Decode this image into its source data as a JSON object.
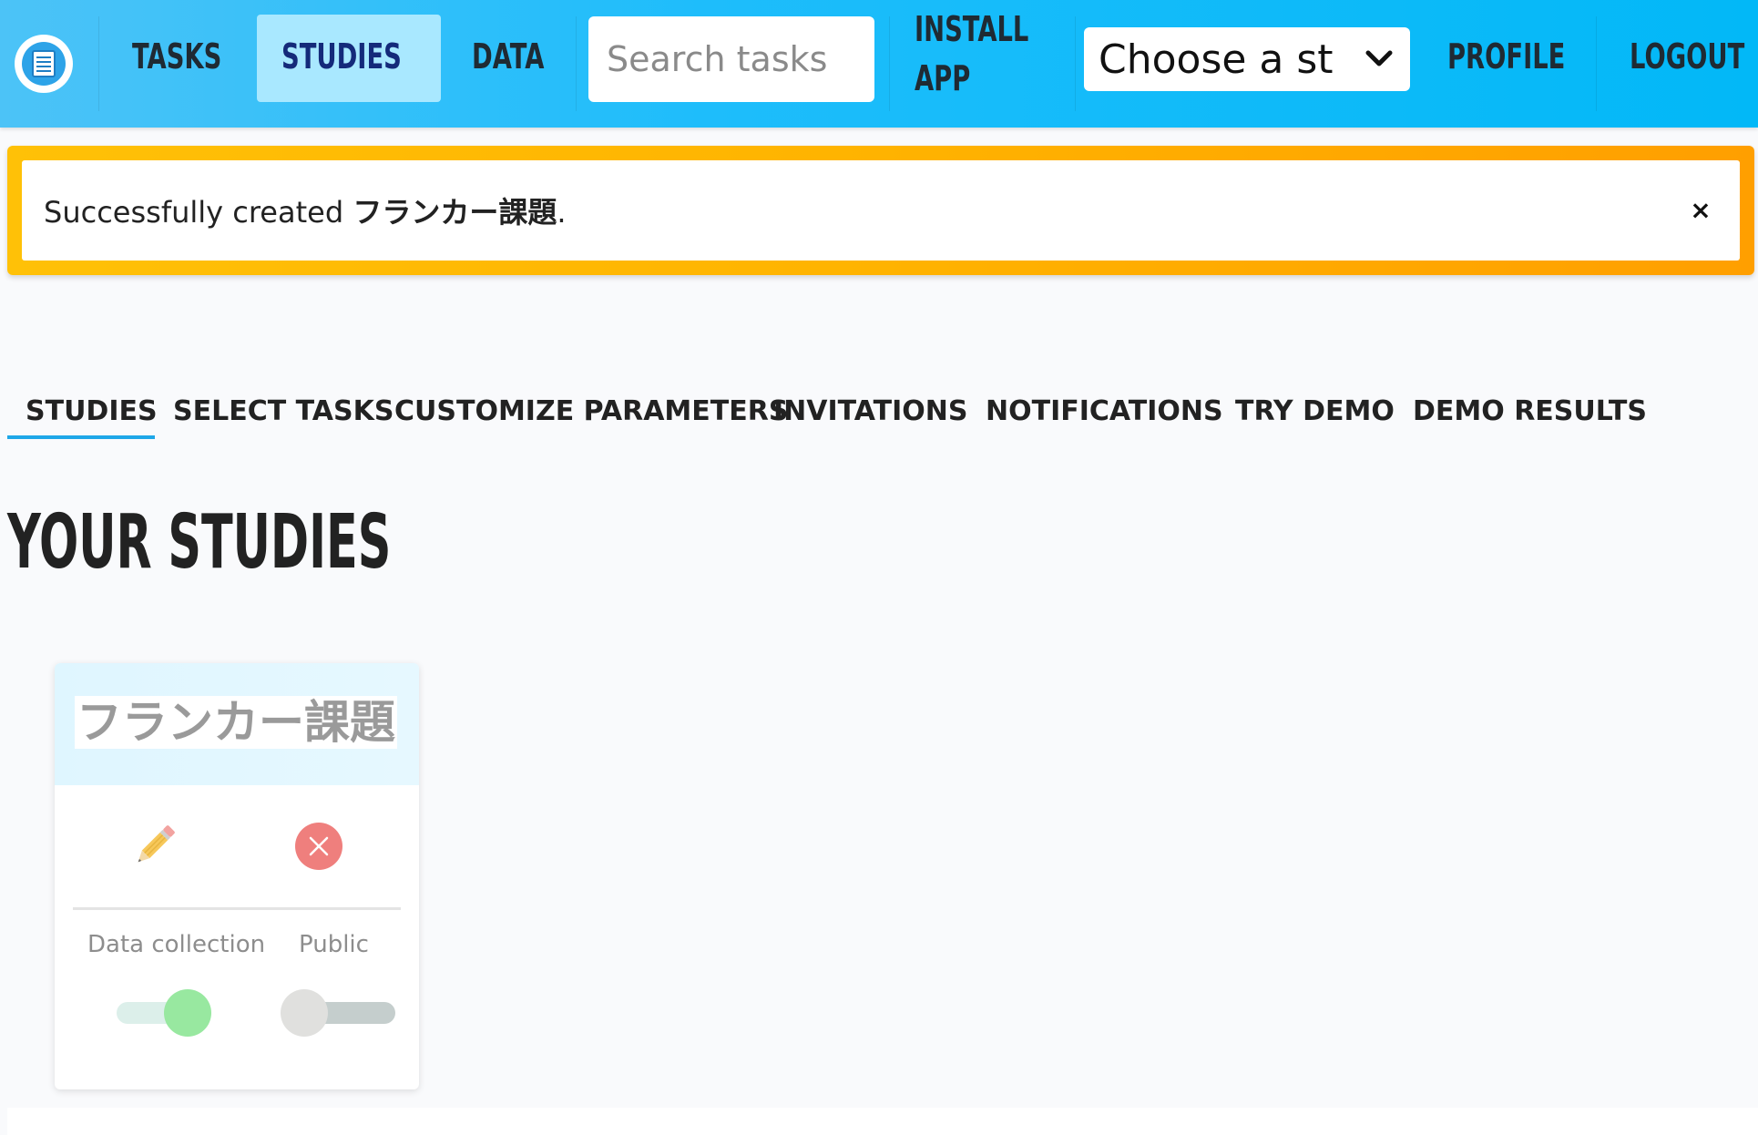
{
  "nav": {
    "logo_icon": "document-icon",
    "links": {
      "tasks": "TASKS",
      "studies": "STUDIES",
      "data": "DATA",
      "install_line1": "INSTALL",
      "install_line2": "APP",
      "profile": "PROFILE",
      "logout": "LOGOUT"
    },
    "search": {
      "placeholder": "Search tasks",
      "value": ""
    },
    "study_select": {
      "selected": "Choose a st"
    },
    "active": "studies"
  },
  "alert": {
    "prefix": "Successfully created ",
    "study_name": "フランカー課題",
    "suffix": ".",
    "close_label": "×"
  },
  "tabs": [
    {
      "label": "STUDIES",
      "active": true
    },
    {
      "label": "SELECT TASKS"
    },
    {
      "label": "CUSTOMIZE PARAMETERS"
    },
    {
      "label": "INVITATIONS"
    },
    {
      "label": "NOTIFICATIONS"
    },
    {
      "label": "TRY DEMO"
    },
    {
      "label": "DEMO RESULTS"
    }
  ],
  "heading": "YOUR STUDIES",
  "studies": [
    {
      "title": "フランカー課題",
      "data_collection_label": "Data collection",
      "public_label": "Public",
      "data_collection_on": true,
      "public_on": false
    }
  ],
  "colors": {
    "nav_bg": "#02b8f7",
    "nav_active_bg": "#a9e8ff",
    "alert_border": "#ffb300",
    "tab_underline": "#1ea7e8",
    "toggle_on_knob": "#98e8a0",
    "toggle_off_knob": "#e0e0de",
    "delete_icon_bg": "#ef7f7d"
  }
}
